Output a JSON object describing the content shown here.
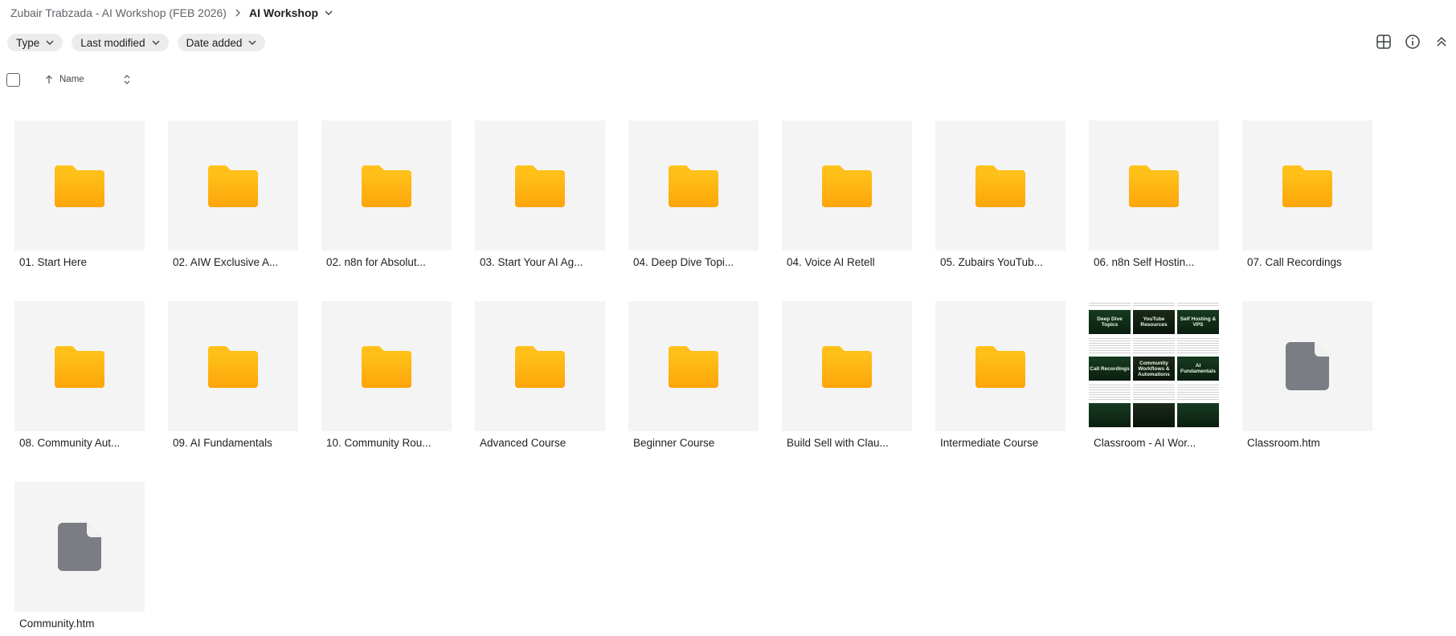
{
  "breadcrumb": {
    "parent": "Zubair Trabzada - AI Workshop (FEB 2026)",
    "current": "AI Workshop"
  },
  "filters": [
    {
      "label": "Type"
    },
    {
      "label": "Last modified"
    },
    {
      "label": "Date added"
    }
  ],
  "toolbar": {
    "icons": [
      "grid-view-icon",
      "info-icon",
      "collapse-icon"
    ]
  },
  "list_header": {
    "name_label": "Name"
  },
  "items": [
    {
      "label": "01. Start Here",
      "kind": "folder"
    },
    {
      "label": "02. AIW Exclusive A...",
      "kind": "folder"
    },
    {
      "label": "02. n8n for Absolut...",
      "kind": "folder"
    },
    {
      "label": "03. Start Your AI Ag...",
      "kind": "folder"
    },
    {
      "label": "04. Deep Dive Topi...",
      "kind": "folder"
    },
    {
      "label": "04. Voice AI Retell",
      "kind": "folder"
    },
    {
      "label": "05. Zubairs YouTub...",
      "kind": "folder"
    },
    {
      "label": "06. n8n Self Hostin...",
      "kind": "folder"
    },
    {
      "label": "07. Call Recordings",
      "kind": "folder"
    },
    {
      "label": "08. Community Aut...",
      "kind": "folder"
    },
    {
      "label": "09. AI Fundamentals",
      "kind": "folder"
    },
    {
      "label": "10. Community Rou...",
      "kind": "folder"
    },
    {
      "label": "Advanced Course",
      "kind": "folder"
    },
    {
      "label": "Beginner Course",
      "kind": "folder"
    },
    {
      "label": "Build Sell with Clau...",
      "kind": "folder"
    },
    {
      "label": "Intermediate Course",
      "kind": "folder"
    },
    {
      "label": "Classroom - AI Wor...",
      "kind": "image"
    },
    {
      "label": "Classroom.htm",
      "kind": "file"
    },
    {
      "label": "Community.htm",
      "kind": "file"
    }
  ],
  "preview_cards": [
    "Deep Dive Topics",
    "YouTube Resources",
    "Self Hosting & VPS",
    "Call Recordings",
    "Community Workflows & Automations",
    "AI Fundamentals"
  ],
  "colors": {
    "folder_top": "#ffc21a",
    "folder_bottom": "#fda50a",
    "file_icon": "#7a7d84",
    "tile_bg": "#f4f4f4",
    "chip_bg": "#ececec"
  }
}
